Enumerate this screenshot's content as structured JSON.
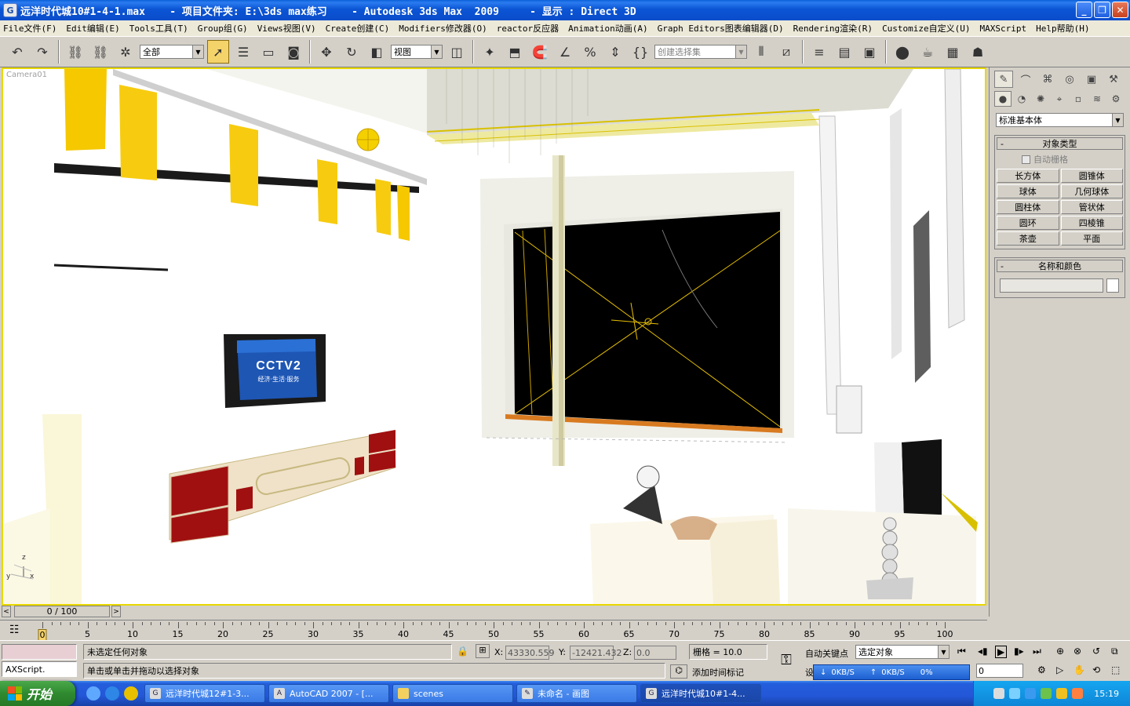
{
  "window": {
    "title": "远洋时代城10#1-4-1.max    - 项目文件夹: E:\\3ds max练习    - Autodesk 3ds Max  2009     - 显示 : Direct 3D"
  },
  "menu": [
    "File文件(F)",
    "Edit编辑(E)",
    "Tools工具(T)",
    "Group组(G)",
    "Views视图(V)",
    "Create创建(C)",
    "Modifiers修改器(O)",
    "reactor反应器",
    "Animation动画(A)",
    "Graph Editors图表编辑器(D)",
    "Rendering渲染(R)",
    "Customize自定义(U)",
    "MAXScript",
    "Help帮助(H)"
  ],
  "toolbar": {
    "selection_filter": "全部",
    "ref_coord": "视图",
    "named_selection_placeholder": "创建选择集"
  },
  "viewport": {
    "label": "Camera01",
    "tv_logo": "CCTV2",
    "tv_sub": "经济·生活·服务",
    "axis_labels": {
      "z": "z",
      "y": "y",
      "x": "x"
    }
  },
  "command_panel": {
    "category": "标准基本体",
    "object_type_title": "对象类型",
    "autogrid_label": "自动栅格",
    "object_buttons": [
      "长方体",
      "圆锥体",
      "球体",
      "几何球体",
      "圆柱体",
      "管状体",
      "圆环",
      "四棱锥",
      "茶壶",
      "平面"
    ],
    "name_color_title": "名称和颜色"
  },
  "time_slider": {
    "position": "0 / 100"
  },
  "trackbar": {
    "ticks": [
      0,
      5,
      10,
      15,
      20,
      25,
      30,
      35,
      40,
      45,
      50,
      55,
      60,
      65,
      70,
      75,
      80,
      85,
      90,
      95,
      100
    ]
  },
  "status": {
    "maxscript_label": "AXScript.",
    "selection_msg": "未选定任何对象",
    "prompt_msg": "单击或单击并拖动以选择对象",
    "x_label": "X:",
    "x_value": "43330.559",
    "y_label": "Y:",
    "y_value": "-12421.432",
    "z_label": "Z:",
    "z_value": "0.0",
    "grid": "栅格 = 10.0",
    "add_time_tag": "添加时间标记",
    "auto_key": "自动关键点",
    "set_key_label": "设",
    "key_filter": "选定对象",
    "frame": "0",
    "net_down": "0KB/S",
    "net_up": "0KB/S",
    "net_pct": "0%"
  },
  "taskbar": {
    "start_label": "开始",
    "tasks": [
      "远洋时代城12#1-3...",
      "AutoCAD 2007 - [...",
      "scenes",
      "未命名 - 画图",
      "远洋时代城10#1-4..."
    ],
    "clock": "15:19"
  },
  "colors": {
    "title_blue": "#0b55d4",
    "viewport_border": "#e8d800",
    "accent_yellow": "#f5c800",
    "cabinet_red": "#a01010"
  }
}
